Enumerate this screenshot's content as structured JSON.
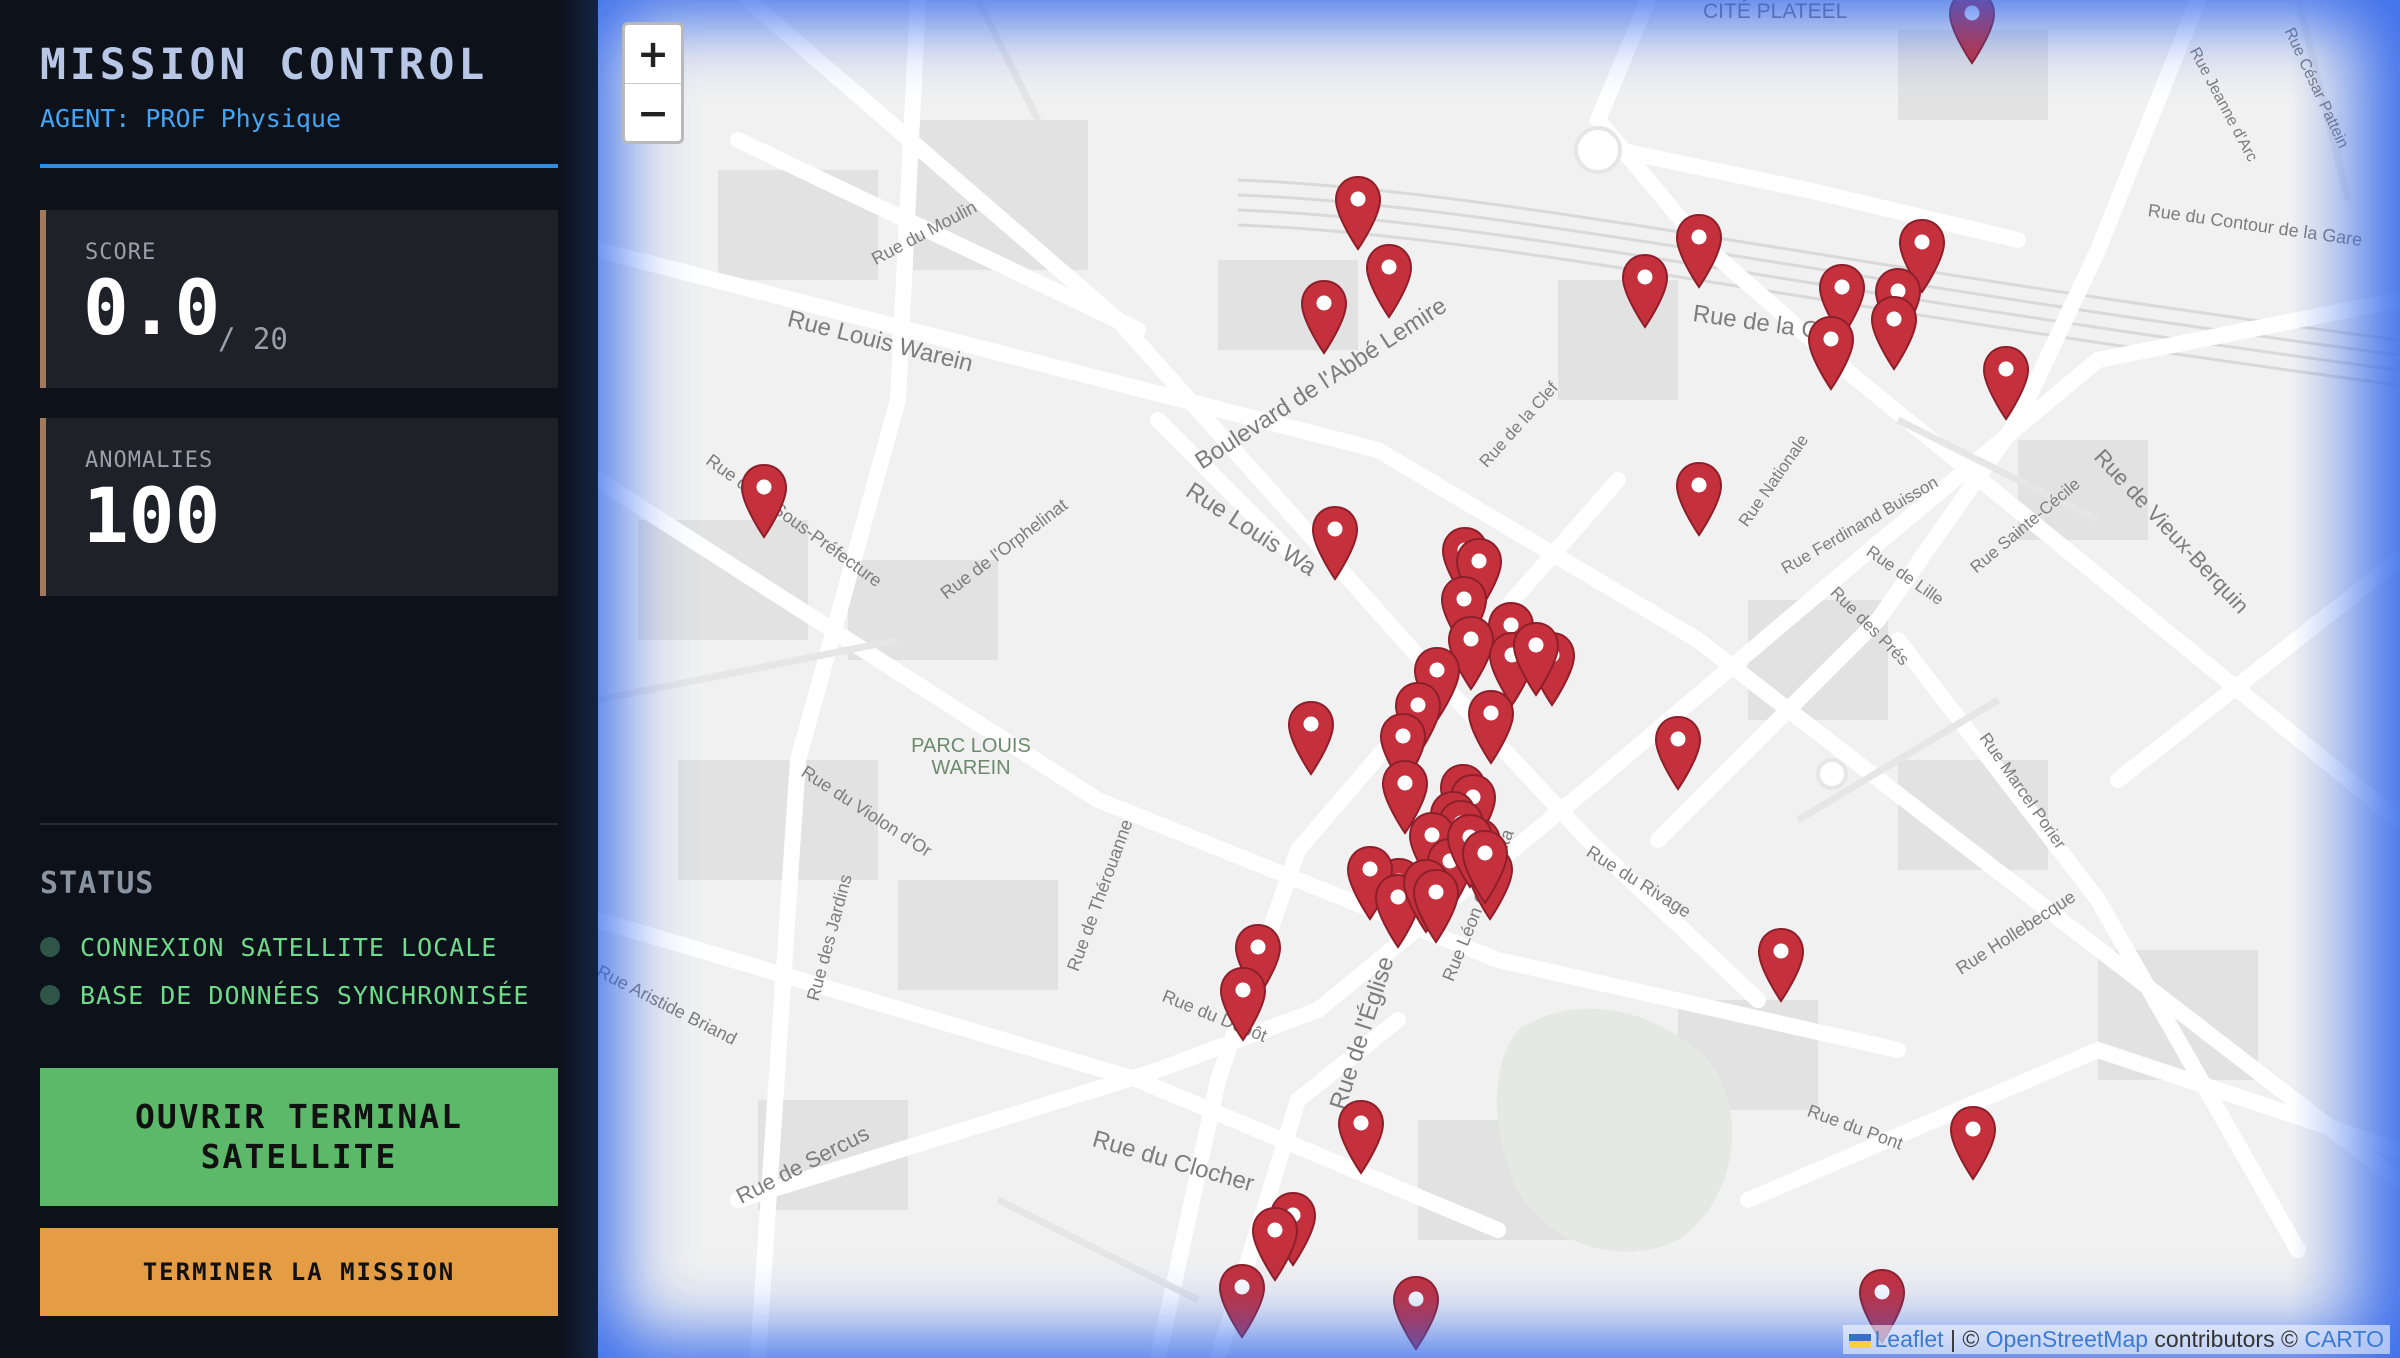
{
  "sidebar": {
    "title": "MISSION CONTROL",
    "agent": "AGENT: PROF Physique",
    "score": {
      "label": "SCORE",
      "value": "0.0",
      "suffix": "/ 20"
    },
    "anomalies": {
      "label": "ANOMALIES",
      "value": "100"
    },
    "status": {
      "title": "STATUS",
      "items": [
        "CONNEXION SATELLITE LOCALE",
        "BASE DE DONNÉES SYNCHRONISÉE"
      ]
    },
    "buttons": {
      "open_terminal": "OUVRIR TERMINAL SATELLITE",
      "end_mission": "TERMINER LA MISSION"
    }
  },
  "map": {
    "zoom_in": "+",
    "zoom_out": "−",
    "labels": {
      "cite": "CITÉ PLATEEL",
      "louis_warein": "Rue Louis Warein",
      "boulevard": "Boulevard de l'Abbé Lemire",
      "louis_w2": "Rue Louis Wa",
      "clocher": "Rue du Clocher",
      "sercus": "Rue de Sercus",
      "eglise": "Rue de l'Église",
      "vieux_berquin": "Rue de Vieux-Berquin",
      "moulin": "Rue du Moulin",
      "sous_prefecture": "Rue de la Sous-Préfecture",
      "orphelinat": "Rue de l'Orphelinat",
      "violon": "Rue du Violon d'Or",
      "therouanne": "Rue de Thérouanne",
      "rivage": "Rue du Rivage",
      "hollebecque": "Rue Hollebecque",
      "pont": "Rue du Pont",
      "depot": "Rue du Dépôt",
      "nationale": "Rue Nationale",
      "ferdinand": "Rue Ferdinand Buisson",
      "contour": "Rue du Contour de la Gare",
      "leon_gambetta": "Rue Léon Gambetta",
      "aristide": "Rue Aristide Briand",
      "jardins": "Rue des Jardins",
      "clef": "Rue de la Clef",
      "gare": "Rue de la G",
      "sainte_cecile": "Rue Sainte-Cécile",
      "lille": "Rue de Lille",
      "pres": "Rue des Prés",
      "marcel_porier": "Rue Marcel Porier",
      "jeanne": "Rue Jeanne d'Arc",
      "cesar": "Rue César Pattein"
    },
    "park": "PARC LOUIS WAREIN",
    "attribution": {
      "leaflet": "Leaflet",
      "sep1": " | © ",
      "osm": "OpenStreetMap",
      "mid": " contributors © ",
      "carto": "CARTO"
    },
    "marker_color": "#c4313d",
    "marker_count_visible": 56
  }
}
